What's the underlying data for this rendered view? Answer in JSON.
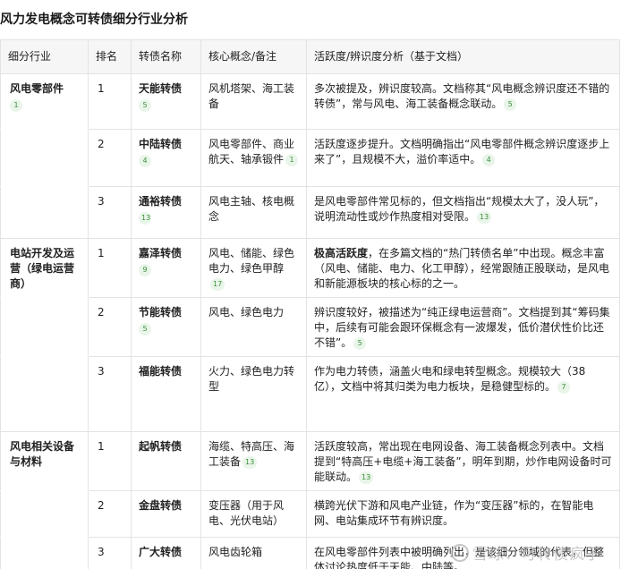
{
  "title": "风力发电概念可转债细分行业分析",
  "table": {
    "headers": [
      "细分行业",
      "排名",
      "转债名称",
      "核心概念/备注",
      "活跃度/辨识度分析（基于文档）"
    ],
    "groups": [
      {
        "category": "风电零部件",
        "category_ref": "1",
        "rows": [
          {
            "rank": "1",
            "name": "天能转债",
            "name_ref": "5",
            "concept": "风机塔架、海工装备",
            "concept_ref": "",
            "analysis_prefix": "",
            "analysis": "多次被提及，辨识度较高。文档称其“风电概念辨识度还不错的转债”，常与风电、海工装备概念联动。",
            "analysis_ref": "5"
          },
          {
            "rank": "2",
            "name": "中陆转债",
            "name_ref": "4",
            "concept": "风电零部件、商业航天、轴承锻件",
            "concept_ref": "1",
            "analysis_prefix": "",
            "analysis": "活跃度逐步提升。文档明确指出“风电零部件概念辨识度逐步上来了”，且规模不大，溢价率适中。",
            "analysis_ref": "4"
          },
          {
            "rank": "3",
            "name": "通裕转债",
            "name_ref": "13",
            "concept": "风电主轴、核电概念",
            "concept_ref": "",
            "analysis_prefix": "",
            "analysis": "是风电零部件常见标的，但文档指出“规模太大了，没人玩”，说明流动性或炒作热度相对受限。",
            "analysis_ref": "13"
          }
        ]
      },
      {
        "category": "电站开发及运营（绿电运营商）",
        "category_ref": "",
        "rows": [
          {
            "rank": "1",
            "name": "嘉泽转债",
            "name_ref": "9",
            "concept": "风电、储能、绿色电力、绿色甲醇",
            "concept_ref": "17",
            "analysis_prefix": "极高活跃度",
            "analysis": "，在多篇文档的“热门转债名单”中出现。概念丰富（风电、储能、电力、化工甲醇），经常跟随正股联动，是风电和新能源板块的核心标的之一。",
            "analysis_ref": ""
          },
          {
            "rank": "2",
            "name": "节能转债",
            "name_ref": "5",
            "concept": "风电、绿色电力",
            "concept_ref": "",
            "analysis_prefix": "",
            "analysis": "辨识度较好，被描述为“纯正绿电运营商”。文档提到其“筹码集中，后续有可能会跟环保概念有一波爆发，低价潜伏性价比还不错”。",
            "analysis_ref": "5"
          },
          {
            "rank": "3",
            "name": "福能转债",
            "name_ref": "",
            "concept": "火力、绿色电力转型",
            "concept_ref": "",
            "analysis_prefix": "",
            "analysis": "作为电力转债，涵盖火电和绿电转型概念。规模较大（38亿），文档中将其归类为电力板块，是稳健型标的。",
            "analysis_ref": "7"
          }
        ]
      },
      {
        "category": "风电相关设备与材料",
        "category_ref": "",
        "rows": [
          {
            "rank": "1",
            "name": "起帆转债",
            "name_ref": "",
            "concept": "海缆、特高压、海工装备",
            "concept_ref": "13",
            "analysis_prefix": "",
            "analysis": "活跃度较高，常出现在电网设备、海工装备概念列表中。文档提到“特高压+电缆+海工装备”，明年到期，炒作电网设备时可能联动。",
            "analysis_ref": "13"
          },
          {
            "rank": "2",
            "name": "金盘转债",
            "name_ref": "",
            "concept": "变压器（用于风电、光伏电站）",
            "concept_ref": "",
            "analysis_prefix": "",
            "analysis": "横跨光伏下游和风电产业链，作为“变压器”标的，在智能电网、电站集成环节有辨识度。",
            "analysis_ref": ""
          },
          {
            "rank": "3",
            "name": "广大转债",
            "name_ref": "",
            "concept": "风电齿轮箱",
            "concept_ref": "",
            "analysis_prefix": "",
            "analysis": "在风电零部件列表中被明确列出，是该细分领域的代表，但整体讨论热度低于天能、中陆等。",
            "analysis_ref": ""
          }
        ]
      }
    ]
  },
  "watermark": "雪球：可转债疯子"
}
